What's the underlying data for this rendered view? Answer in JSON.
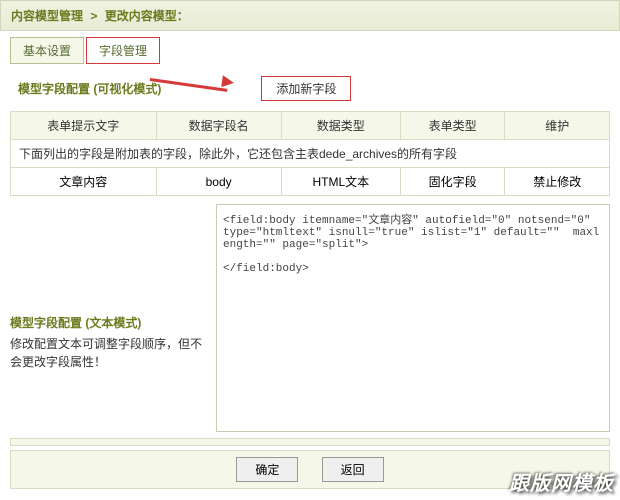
{
  "breadcrumb": {
    "a": "内容模型管理",
    "b": "更改内容模型：",
    "sep": ">"
  },
  "tabs": {
    "basic": "基本设置",
    "field": "字段管理"
  },
  "section": {
    "visual": "模型字段配置 (可视化模式)",
    "add_btn": "添加新字段"
  },
  "table": {
    "headers": [
      "表单提示文字",
      "数据字段名",
      "数据类型",
      "表单类型",
      "维护"
    ],
    "note": "下面列出的字段是附加表的字段，除此外，它还包含主表dede_archives的所有字段",
    "row": [
      "文章内容",
      "body",
      "HTML文本",
      "固化字段",
      "禁止修改"
    ]
  },
  "text_mode": {
    "title": "模型字段配置 (文本模式)",
    "desc": "修改配置文本可调整字段顺序，但不会更改字段属性！"
  },
  "code": "<field:body itemname=\"文章内容\" autofield=\"0\" notsend=\"0\" type=\"htmltext\" isnull=\"true\" islist=\"1\" default=\"\"  maxlength=\"\" page=\"split\">\n\n</field:body>",
  "footer": {
    "ok": "确定",
    "back": "返回"
  },
  "watermark": "跟版网模板"
}
